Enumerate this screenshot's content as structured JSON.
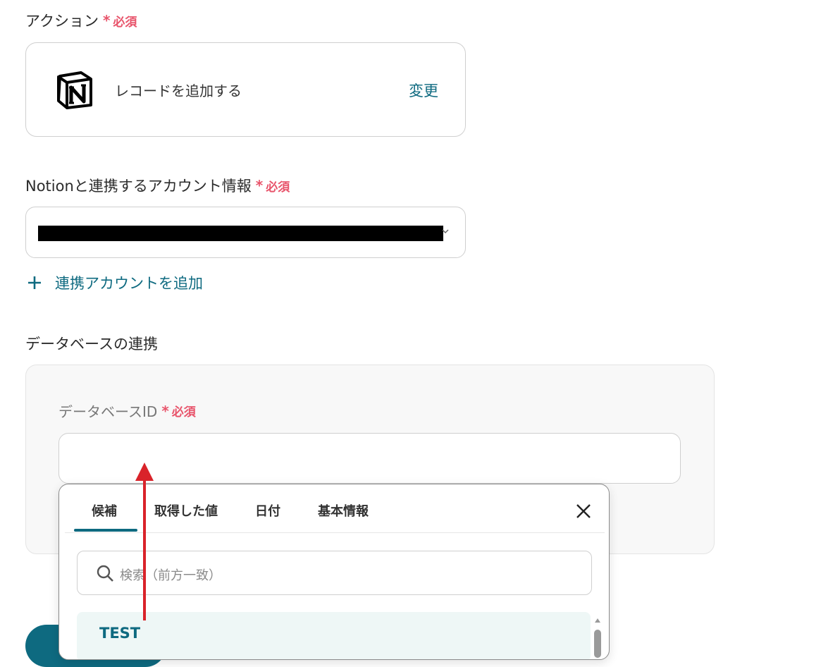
{
  "required": {
    "mark": "*",
    "text": "必須"
  },
  "action": {
    "label": "アクション",
    "name": "レコードを追加する",
    "change_label": "変更",
    "icon": "notion-logo"
  },
  "account": {
    "label": "Notionと連携するアカウント情報",
    "selected_value": "",
    "add_label": "連携アカウントを追加",
    "add_icon": "plus-icon"
  },
  "database": {
    "section_label": "データベースの連携",
    "id_label": "データベースID",
    "id_value": ""
  },
  "popover": {
    "tabs": [
      "候補",
      "取得した値",
      "日付",
      "基本情報"
    ],
    "active_tab": "候補",
    "search_placeholder": "検索（前方一致）",
    "items": [
      "TEST"
    ]
  },
  "colors": {
    "accent": "#0e6a80",
    "required": "#e8546b",
    "annotation_arrow": "#d9232a"
  }
}
